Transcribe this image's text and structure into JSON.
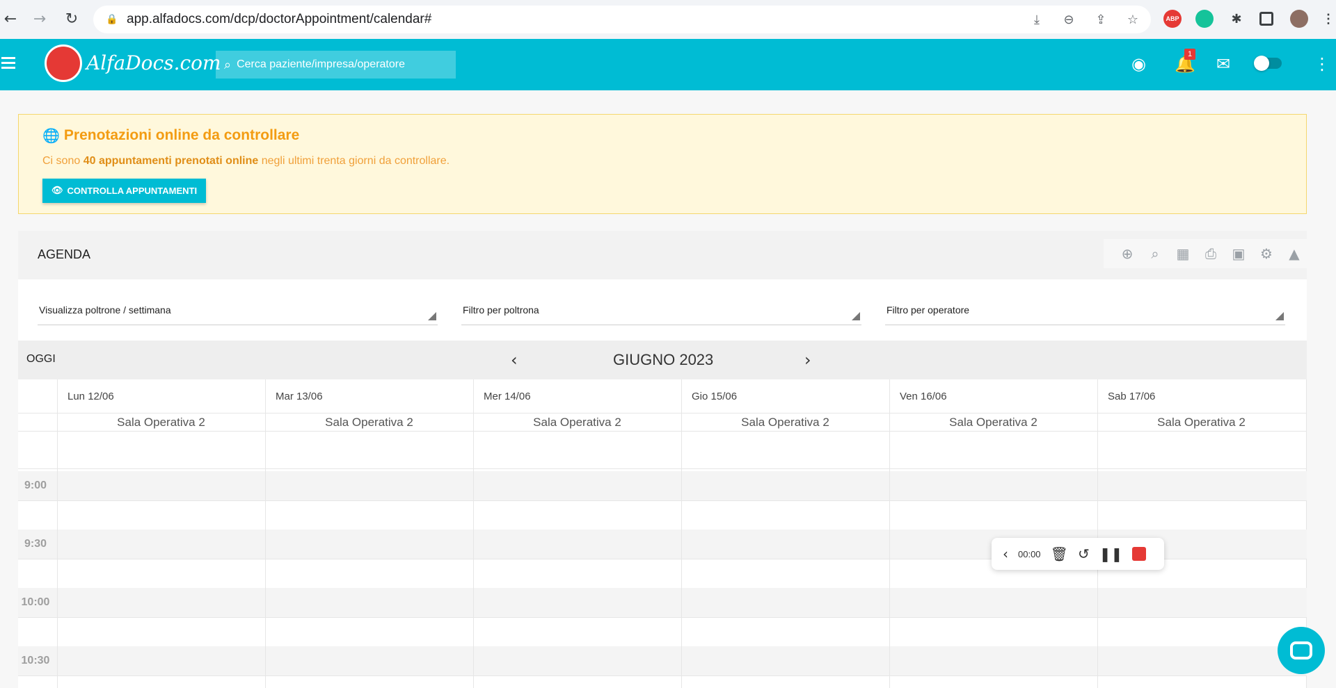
{
  "browser": {
    "url": "app.alfadocs.com/dcp/doctorAppointment/calendar#",
    "extensions": [
      "ABP"
    ]
  },
  "header": {
    "logo_text": "AlfaDocs.com",
    "search_placeholder": "Cerca paziente/impresa/operatore",
    "notification_count": "1"
  },
  "alert": {
    "title": "Prenotazioni online da controllare",
    "text_before": "Ci sono ",
    "text_bold": "40 appuntamenti prenotati online",
    "text_after": " negli ultimi trenta giorni da controllare.",
    "button_label": "CONTROLLA APPUNTAMENTI",
    "color": "#f39c12"
  },
  "agenda": {
    "title": "AGENDA",
    "toolbar_icons": [
      "add-icon",
      "search-icon",
      "calendar-icon",
      "print-icon",
      "settings-case-icon",
      "gears-icon",
      "graduation-cap-icon"
    ]
  },
  "filters": [
    {
      "label": "Visualizza poltrone / settimana"
    },
    {
      "label": "Filtro per poltrona"
    },
    {
      "label": "Filtro per operatore"
    }
  ],
  "calendar": {
    "today_label": "OGGI",
    "month_label": "GIUGNO 2023",
    "days": [
      {
        "label": "Lun 12/06",
        "room": "Sala Operativa 2"
      },
      {
        "label": "Mar 13/06",
        "room": "Sala Operativa 2"
      },
      {
        "label": "Mer 14/06",
        "room": "Sala Operativa 2"
      },
      {
        "label": "Gio 15/06",
        "room": "Sala Operativa 2"
      },
      {
        "label": "Ven 16/06",
        "room": "Sala Operativa 2"
      },
      {
        "label": "Sab 17/06",
        "room": "Sala Operativa 2"
      }
    ],
    "times": [
      "9:00",
      "9:30",
      "10:00",
      "10:30"
    ]
  },
  "recorder": {
    "time": "00:00"
  },
  "colors": {
    "primary": "#00bcd4",
    "alert_bg": "#fff8dc",
    "danger": "#e53935"
  }
}
